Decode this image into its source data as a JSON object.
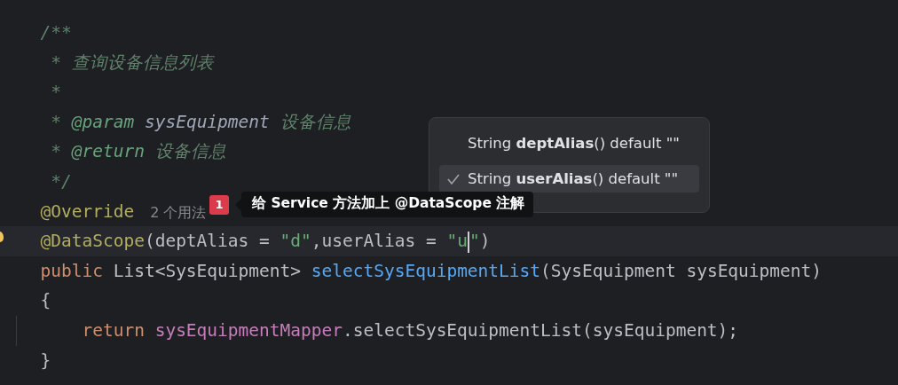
{
  "code_lines": [
    {
      "current": false,
      "bulb": false,
      "tokens": [
        {
          "text": "/**",
          "kind": "comment"
        }
      ]
    },
    {
      "current": false,
      "bulb": false,
      "tokens": [
        {
          "text": " * ",
          "kind": "comment"
        },
        {
          "text": "查询设备信息列表",
          "kind": "comment"
        }
      ]
    },
    {
      "current": false,
      "bulb": false,
      "tokens": [
        {
          "text": " *",
          "kind": "comment"
        }
      ]
    },
    {
      "current": false,
      "bulb": false,
      "tokens": [
        {
          "text": " * ",
          "kind": "comment"
        },
        {
          "text": "@param",
          "kind": "doctag"
        },
        {
          "text": " sysEquipment",
          "kind": "docparam"
        },
        {
          "text": " 设备信息",
          "kind": "comment"
        }
      ]
    },
    {
      "current": false,
      "bulb": false,
      "tokens": [
        {
          "text": " * ",
          "kind": "comment"
        },
        {
          "text": "@return",
          "kind": "doctag"
        },
        {
          "text": " 设备信息",
          "kind": "comment"
        }
      ]
    },
    {
      "current": false,
      "bulb": false,
      "tokens": [
        {
          "text": " */",
          "kind": "comment"
        }
      ]
    },
    {
      "current": false,
      "bulb": false,
      "tokens": [
        {
          "text": "@Override",
          "kind": "annotation"
        },
        {
          "text": "2 个用法",
          "kind": "hint"
        }
      ]
    },
    {
      "current": true,
      "bulb": true,
      "tokens": [
        {
          "text": "@DataScope",
          "kind": "annotation"
        },
        {
          "text": "(deptAlias = ",
          "kind": "plain"
        },
        {
          "text": "\"d\"",
          "kind": "string"
        },
        {
          "text": ",userAlias = ",
          "kind": "plain"
        },
        {
          "text": "\"u",
          "kind": "string",
          "caret": true
        },
        {
          "text": "\"",
          "kind": "string"
        },
        {
          "text": ")",
          "kind": "plain"
        }
      ]
    },
    {
      "current": false,
      "bulb": false,
      "tokens": [
        {
          "text": "public",
          "kind": "keyword"
        },
        {
          "text": " List<SysEquipment> ",
          "kind": "plain"
        },
        {
          "text": "selectSysEquipmentList",
          "kind": "method"
        },
        {
          "text": "(SysEquipment sysEquipment)",
          "kind": "plain"
        }
      ]
    },
    {
      "current": false,
      "bulb": false,
      "tokens": [
        {
          "text": "{",
          "kind": "plain"
        }
      ]
    },
    {
      "current": false,
      "bulb": false,
      "guide": true,
      "tokens": [
        {
          "text": "    return",
          "kind": "keyword"
        },
        {
          "text": " sysEquipmentMapper",
          "kind": "field"
        },
        {
          "text": ".selectSysEquipmentList(sysEquipment);",
          "kind": "plain"
        }
      ]
    },
    {
      "current": false,
      "bulb": false,
      "tokens": [
        {
          "text": "}",
          "kind": "plain"
        }
      ]
    }
  ],
  "tooltip": {
    "badge": "1",
    "text": "给 Service 方法加上 @DataScope 注解"
  },
  "completion_popup": {
    "items": [
      {
        "text": "String **deptAlias**() default \"\"",
        "selected": false
      },
      {
        "text": "String **userAlias**() default \"\"",
        "selected": true
      }
    ]
  }
}
